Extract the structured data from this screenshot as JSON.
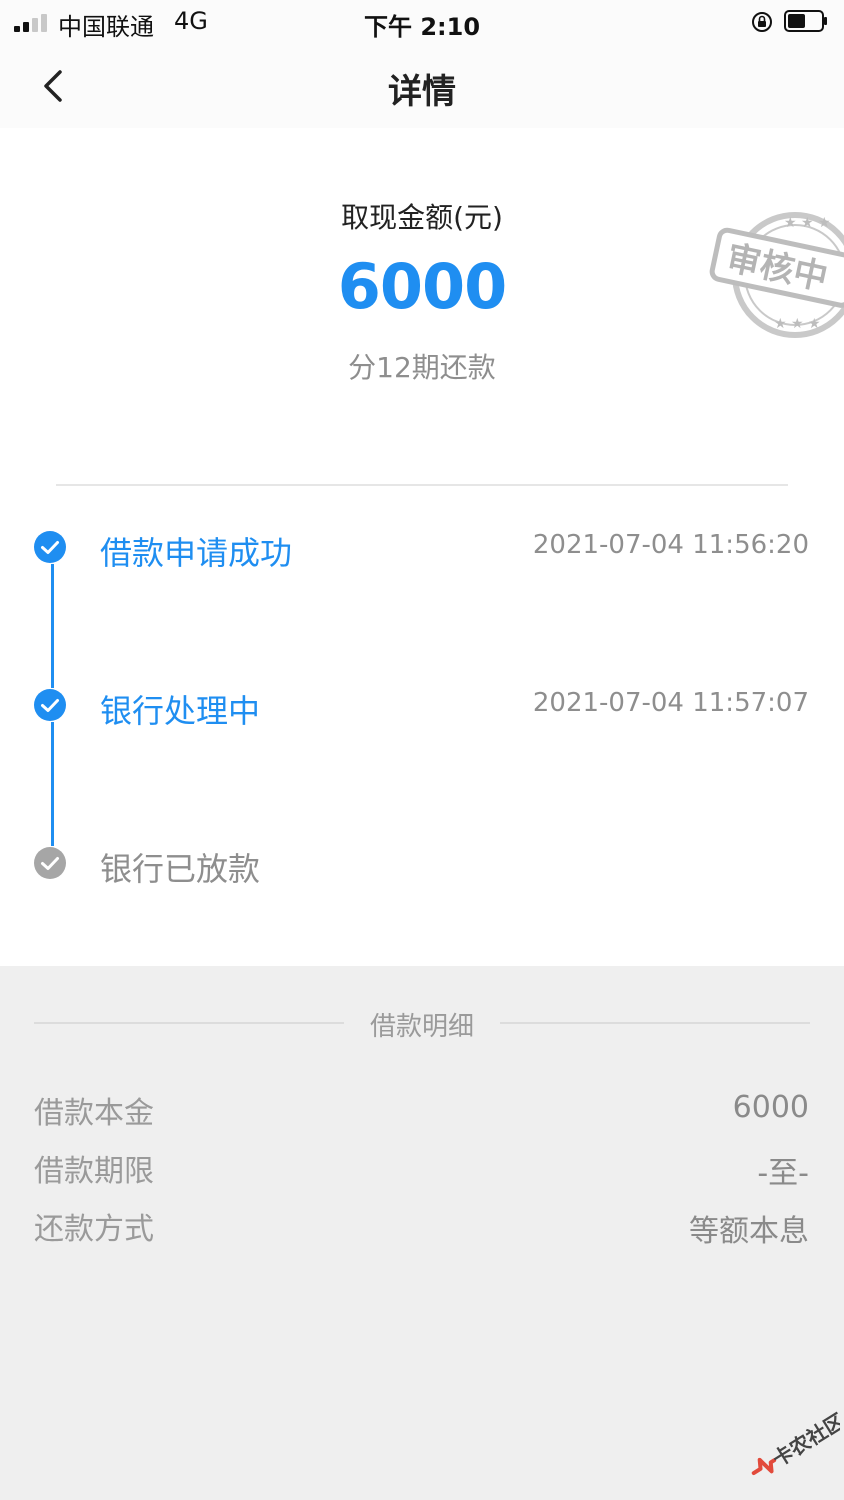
{
  "status_bar": {
    "carrier": "中国联通",
    "network": "4G",
    "time": "下午 2:10"
  },
  "nav": {
    "title": "详情",
    "back_icon": "chevron-left-icon"
  },
  "summary": {
    "amount_label": "取现金额(元)",
    "amount": "6000",
    "installments": "分12期还款",
    "stamp_text": "审核中"
  },
  "timeline": [
    {
      "label": "借款申请成功",
      "time": "2021-07-04 11:56:20",
      "state": "done"
    },
    {
      "label": "银行处理中",
      "time": "2021-07-04 11:57:07",
      "state": "done"
    },
    {
      "label": "银行已放款",
      "time": "",
      "state": "pending"
    }
  ],
  "details": {
    "title": "借款明细",
    "rows": [
      {
        "label": "借款本金",
        "value": "6000"
      },
      {
        "label": "借款期限",
        "value": "-至-"
      },
      {
        "label": "还款方式",
        "value": "等额本息"
      }
    ]
  },
  "watermark": {
    "text": "卡农社区"
  },
  "colors": {
    "accent": "#1f8ef1",
    "pending": "#a6a6a6",
    "muted_text": "#8e8e8e",
    "panel_bg": "#efefef"
  }
}
